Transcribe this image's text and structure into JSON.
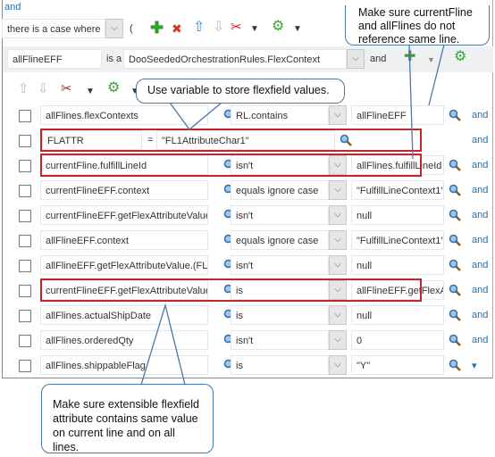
{
  "top_link": "and",
  "condition_select": "there is a case where",
  "paren": "(",
  "toolbar1": {
    "icons": [
      "add-icon",
      "delete-icon",
      "move-up-icon",
      "move-down-icon",
      "cut-icon",
      "dropdown-icon",
      "settings-icon",
      "dropdown-icon"
    ]
  },
  "fact": {
    "name": "allFlineEFF",
    "is_a": "is a",
    "type": "DooSeededOrchestrationRules.FlexContext",
    "and": "and"
  },
  "rows": [
    {
      "left": "allFlines.flexContexts",
      "op": "RL.contains",
      "right": "allFlineEFF",
      "conj": "and"
    },
    {
      "left": "FLATTR",
      "op": "=",
      "right": "\"FL1AttributeChar1\"",
      "conj": "and",
      "assign": true,
      "highlight": true
    },
    {
      "left": "currentFline.fulfillLineId",
      "op": "isn't",
      "right": "allFlines.fulfillLineId",
      "conj": "and",
      "highlight": true
    },
    {
      "left": "currentFlineEFF.context",
      "op": "equals ignore case",
      "right": "\"FulfillLineContext1\"",
      "conj": "and"
    },
    {
      "left": "currentFlineEFF.getFlexAttributeValue.(FLATTR)",
      "op": "isn't",
      "right": "null",
      "conj": "and"
    },
    {
      "left": "allFlineEFF.context",
      "op": "equals ignore case",
      "right": "\"FulfillLineContext1\"",
      "conj": "and"
    },
    {
      "left": "allFlineEFF.getFlexAttributeValue.(FLATTR)",
      "op": "isn't",
      "right": "null",
      "conj": "and"
    },
    {
      "left": "currentFlineEFF.getFlexAttributeValue.(FLATTR)",
      "op": "is",
      "right": "allFlineEFF.getFlexAttributeValue.(FLATTR)",
      "conj": "and",
      "highlight": true
    },
    {
      "left": "allFlines.actualShipDate",
      "op": "is",
      "right": "null",
      "conj": "and"
    },
    {
      "left": "allFlines.orderedQty",
      "op": "isn't",
      "right": "0",
      "conj": "and"
    },
    {
      "left": "allFlines.shippableFlag",
      "op": "is",
      "right": "\"Y\"",
      "conj": "▾"
    }
  ],
  "callouts": {
    "top_right": "Make sure currentFline and allFlines do not reference same line.",
    "middle": "Use variable to store flexfield values.",
    "bottom": "Make sure extensible flexfield attribute contains same value on current line and on all lines."
  },
  "colors": {
    "link": "#1f6fb5",
    "highlight": "#c0272d",
    "callout_border": "#4a78a8"
  }
}
